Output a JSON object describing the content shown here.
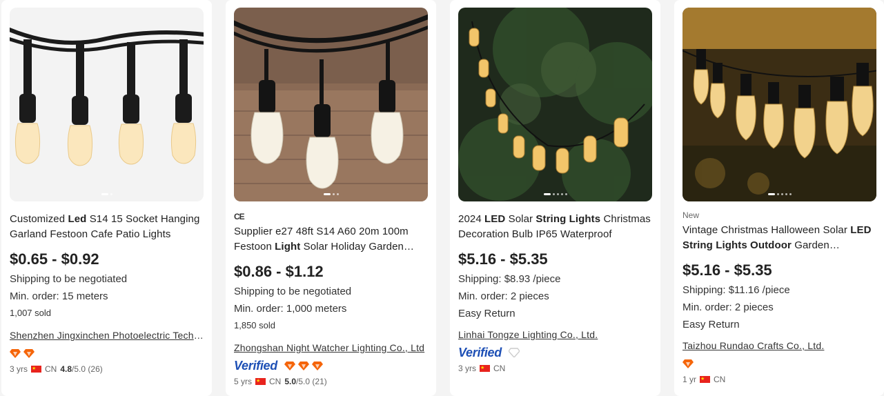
{
  "products": [
    {
      "tag": "",
      "cert": "",
      "title_parts": [
        {
          "text": "Customized ",
          "bold": false
        },
        {
          "text": "Led",
          "bold": true
        },
        {
          "text": " S14 15 Socket Hanging Garland Festoon Cafe Patio Lights",
          "bold": false
        }
      ],
      "price": "$0.65 - $0.92",
      "shipping": "Shipping to be negotiated",
      "min_order": "Min. order: 15 meters",
      "sold": "1,007 sold",
      "easy_return": "",
      "supplier": "Shenzhen Jingxinchen Photoelectric Technology Co., Ltd.",
      "verified": "",
      "diamonds": 2,
      "years": "3 yrs",
      "country": "CN",
      "rating": "4.8",
      "rating_max": "/5.0 (26)",
      "carousel_dots": 2
    },
    {
      "tag": "",
      "cert": "CE",
      "title_parts": [
        {
          "text": "Supplier e27 48ft S14 A60 20m 100m Festoon ",
          "bold": false
        },
        {
          "text": "Light",
          "bold": true
        },
        {
          "text": " Solar Holiday Garden Decoration",
          "bold": false
        }
      ],
      "price": "$0.86 - $1.12",
      "shipping": "Shipping to be negotiated",
      "min_order": "Min. order: 1,000 meters",
      "sold": "1,850 sold",
      "easy_return": "",
      "supplier": "Zhongshan Night Watcher Lighting Co., Ltd",
      "verified": "Verified",
      "diamonds": 3,
      "years": "5 yrs",
      "country": "CN",
      "rating": "5.0",
      "rating_max": "/5.0 (21)",
      "carousel_dots": 3
    },
    {
      "tag": "",
      "cert": "",
      "title_parts": [
        {
          "text": "2024 ",
          "bold": false
        },
        {
          "text": "LED",
          "bold": true
        },
        {
          "text": " Solar ",
          "bold": false
        },
        {
          "text": "String Lights",
          "bold": true
        },
        {
          "text": " Christmas Decoration Bulb IP65 Waterproof",
          "bold": false
        }
      ],
      "price": "$5.16 - $5.35",
      "shipping": "Shipping: $8.93 /piece",
      "min_order": "Min. order: 2 pieces",
      "sold": "",
      "easy_return": "Easy Return",
      "supplier": "Linhai Tongze Lighting Co., Ltd.",
      "verified": "Verified",
      "diamonds": 0,
      "grey_diamond": true,
      "years": "3 yrs",
      "country": "CN",
      "rating": "",
      "rating_max": "",
      "carousel_dots": 5
    },
    {
      "tag": "New",
      "cert": "",
      "title_parts": [
        {
          "text": "Vintage Christmas Halloween Solar ",
          "bold": false
        },
        {
          "text": "LED String Lights Outdoor",
          "bold": true
        },
        {
          "text": " Garden Decoration",
          "bold": false
        }
      ],
      "price": "$5.16 - $5.35",
      "shipping": "Shipping: $11.16 /piece",
      "min_order": "Min. order: 2 pieces",
      "sold": "",
      "easy_return": "Easy Return",
      "supplier": "Taizhou Rundao Crafts Co., Ltd.",
      "verified": "",
      "diamonds": 1,
      "years": "1 yr",
      "country": "CN",
      "rating": "",
      "rating_max": "",
      "carousel_dots": 5
    }
  ],
  "colors": {
    "verified_blue": "#1d4fb5",
    "diamond_orange": "#f5650a"
  }
}
